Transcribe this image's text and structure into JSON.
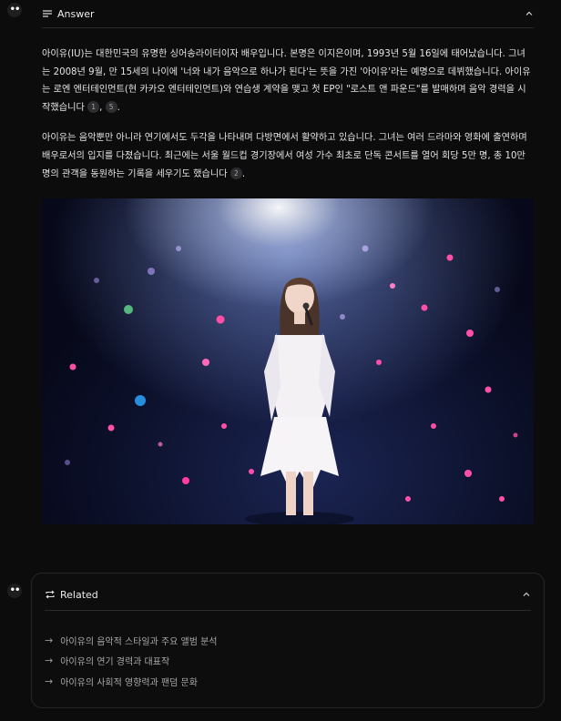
{
  "answer": {
    "header_label": "Answer",
    "paragraphs": [
      {
        "text": "아이유(IU)는 대한민국의 유명한 싱어송라이터이자 배우입니다. 본명은 이지은이며, 1993년 5월 16일에 태어났습니다. 그녀는 2008년 9월, 만 15세의 나이에 '너와 내가 음악으로 하나가 된다'는 뜻을 가진 '아이유'라는 예명으로 데뷔했습니다. 아이유는 로엔 엔터테인먼트(현 카카오 엔터테인먼트)와 연습생 계약을 맺고 첫 EP인 \"로스트 앤 파운드\"를 발매하며 음악 경력을 시작했습니다",
        "cite1": "1",
        "sep": ",",
        "cite2": "5",
        "end": "."
      },
      {
        "text": "아이유는 음악뿐만 아니라 연기에서도 두각을 나타내며 다방면에서 활약하고 있습니다. 그녀는 여러 드라마와 영화에 출연하며 배우로서의 입지를 다졌습니다. 최근에는 서울 월드컵 경기장에서 여성 가수 최초로 단독 콘서트를 열어 회당 5만 명, 총 10만 명의 관객을 동원하는 기록을 세우기도 했습니다",
        "cite1": "2",
        "end": "."
      }
    ]
  },
  "related": {
    "header_label": "Related",
    "items": [
      "아이유의 음악적 스타일과 주요 앨범 분석",
      "아이유의 연기 경력과 대표작",
      "아이유의 사회적 영향력과 팬덤 문화"
    ]
  },
  "icons": {
    "menu": "lines-icon",
    "collapse": "chevron-up-icon",
    "related": "repeat-icon",
    "arrow": "arrow-right-icon",
    "more": "more-dots-icon"
  }
}
